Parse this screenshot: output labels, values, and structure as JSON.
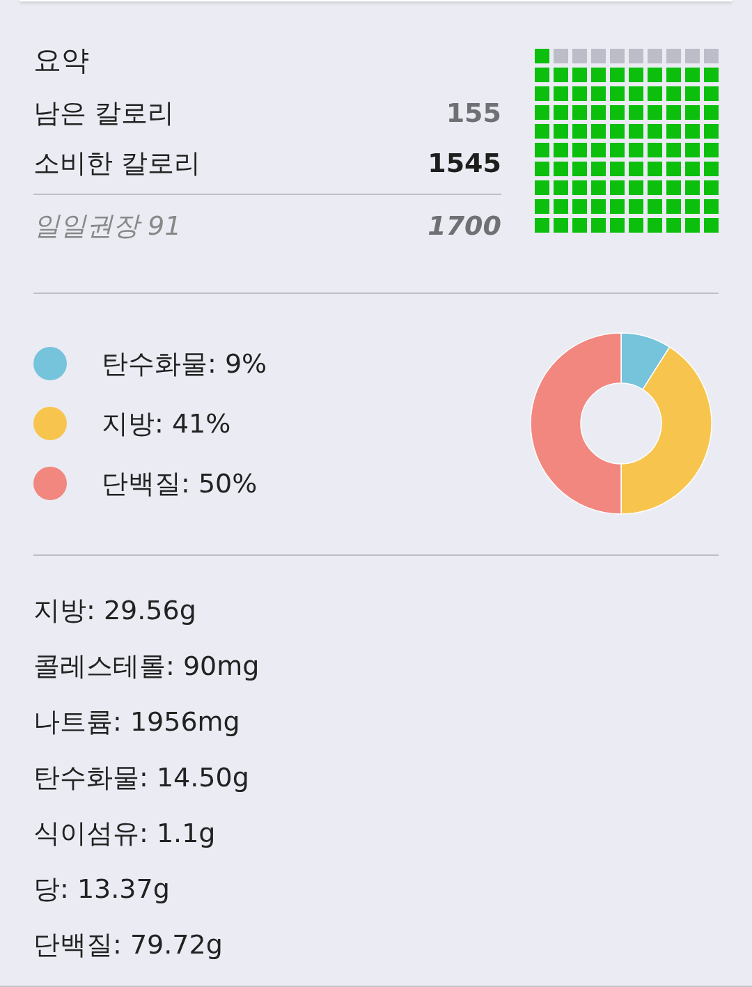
{
  "summary": {
    "title": "요약",
    "rows": [
      {
        "kind": "remaining",
        "label": "남은 칼로리",
        "value": "155"
      },
      {
        "kind": "consumed",
        "label": "소비한 칼로리",
        "value": "1545"
      },
      {
        "kind": "goal",
        "label": "일일권장 91",
        "value": "1700"
      }
    ],
    "waffle": {
      "level": 0.91
    }
  },
  "macros": {
    "legend": [
      {
        "label": "탄수화물: 9%",
        "color": "#76c3dc"
      },
      {
        "label": "지방: 41%",
        "color": "#f7c54e"
      },
      {
        "label": "단백질: 50%",
        "color": "#f1877f"
      }
    ],
    "chart_data": {
      "type": "donut",
      "values": [
        9,
        41,
        50
      ]
    }
  },
  "nutrients": [
    "지방: 29.56g",
    "콜레스테롤: 90mg",
    "나트륨: 1956mg",
    "탄수화물: 14.50g",
    "식이섬유: 1.1g",
    "당: 13.37g",
    "단백질: 79.72g"
  ]
}
